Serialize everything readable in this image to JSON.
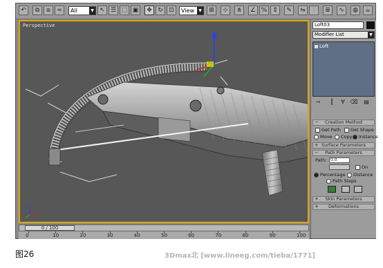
{
  "toolbar": {
    "filter_value": "All",
    "refcoord_value": "View"
  },
  "viewport": {
    "label": "Perspective"
  },
  "timeline": {
    "slider_text": "0 / 100",
    "ticks": [
      "0",
      "10",
      "20",
      "30",
      "40",
      "50",
      "60",
      "70",
      "80",
      "90",
      "100"
    ]
  },
  "command_panel": {
    "object_name": "Loft03",
    "modifier_list": "Modifier List",
    "stack_items": [
      "Loft"
    ],
    "rollouts": {
      "creation_method": "Creation Method",
      "get_path": "Get Path",
      "get_shape": "Get Shape",
      "move": "Move",
      "copy": "Copy",
      "instance": "Instance",
      "surface_parameters": "Surface Parameters",
      "path_parameters": "Path Parameters",
      "path_label": "Path:",
      "path_value": "0.0",
      "snap_on": "On",
      "percentage": "Percentage",
      "distance": "Distance",
      "path_steps": "Path Steps",
      "skin_parameters": "Skin Parameters",
      "deformations": "Deformations"
    }
  },
  "caption": "图26",
  "watermark": "3Dmax北 [www.lineeg.com/tieba/1771]",
  "colors": {
    "viewport_border": "#e0a800",
    "viewport_bg": "#575757",
    "panel_bg": "#9c9c9c",
    "stack_bg": "#5f6f85"
  }
}
